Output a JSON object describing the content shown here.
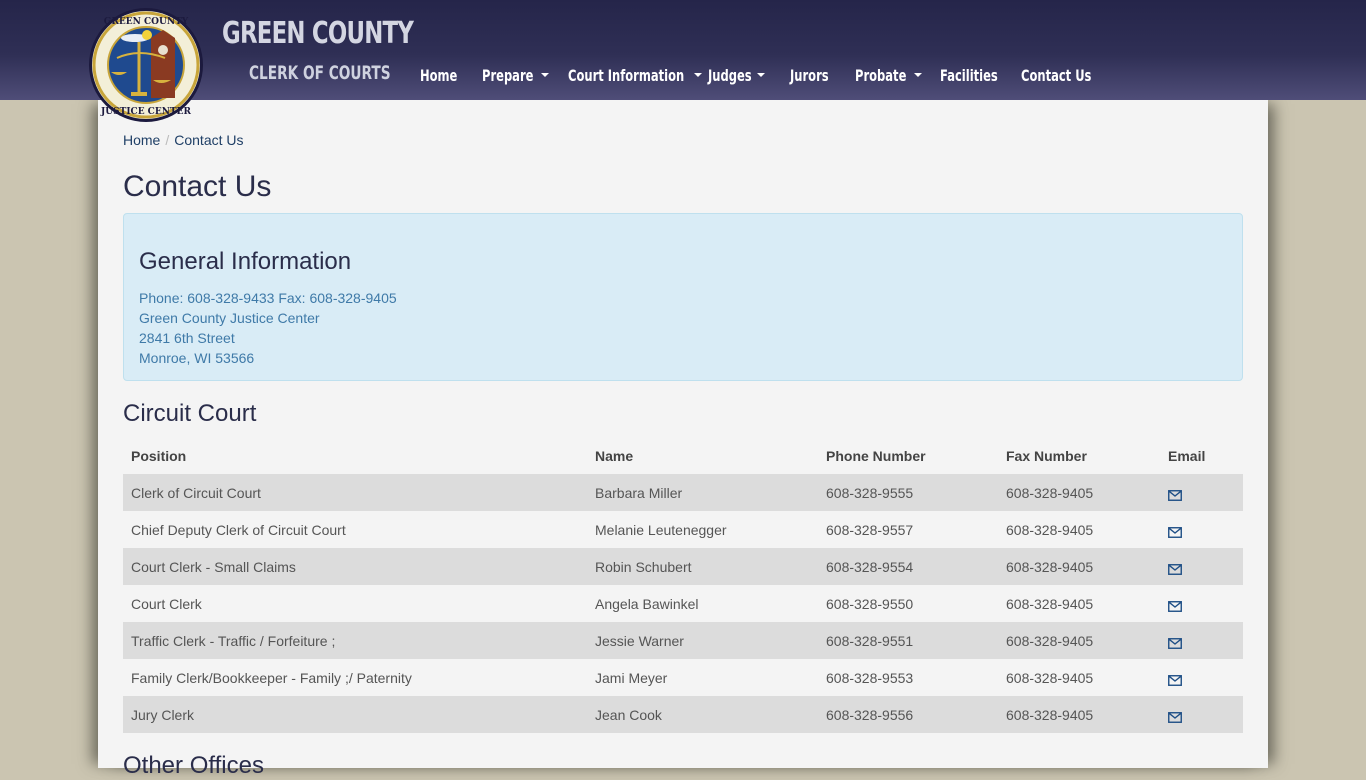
{
  "brand": {
    "title": "GREEN COUNTY",
    "subtitle": "CLERK OF COURTS",
    "logo_alt": "Green County Justice Center seal"
  },
  "nav": [
    {
      "label": "Home",
      "dropdown": false
    },
    {
      "label": "Prepare",
      "dropdown": true
    },
    {
      "label": "Court Information",
      "dropdown": true
    },
    {
      "label": "Judges",
      "dropdown": true
    },
    {
      "label": "Jurors",
      "dropdown": false
    },
    {
      "label": "Probate",
      "dropdown": true
    },
    {
      "label": "Facilities",
      "dropdown": false
    },
    {
      "label": "Contact Us",
      "dropdown": false
    }
  ],
  "breadcrumb": {
    "home": "Home",
    "separator": "/",
    "current": "Contact Us"
  },
  "page_title": "Contact Us",
  "general_info": {
    "heading": "General Information",
    "phone_line": "Phone: 608-328-9433 Fax: 608-328-9405",
    "org": "Green County Justice Center",
    "street": "2841 6th Street",
    "city": "Monroe, WI 53566"
  },
  "circuit_court": {
    "heading": "Circuit Court",
    "columns": [
      "Position",
      "Name",
      "Phone Number",
      "Fax Number",
      "Email"
    ],
    "rows": [
      {
        "position": "Clerk of Circuit Court",
        "name": "Barbara Miller",
        "phone": "608-328-9555",
        "fax": "608-328-9405",
        "email_icon": "envelope-icon"
      },
      {
        "position": "Chief Deputy Clerk of Circuit Court",
        "name": "Melanie Leutenegger",
        "phone": "608-328-9557",
        "fax": "608-328-9405",
        "email_icon": "envelope-icon"
      },
      {
        "position": "Court Clerk - Small Claims",
        "name": "Robin Schubert",
        "phone": "608-328-9554",
        "fax": "608-328-9405",
        "email_icon": "envelope-icon"
      },
      {
        "position": "Court Clerk",
        "name": "Angela Bawinkel",
        "phone": "608-328-9550",
        "fax": "608-328-9405",
        "email_icon": "envelope-icon"
      },
      {
        "position": "Traffic Clerk - Traffic / Forfeiture ;",
        "name": "Jessie Warner",
        "phone": "608-328-9551",
        "fax": "608-328-9405",
        "email_icon": "envelope-icon"
      },
      {
        "position": "Family Clerk/Bookkeeper - Family ;/ Paternity",
        "name": "Jami Meyer",
        "phone": "608-328-9553",
        "fax": "608-328-9405",
        "email_icon": "envelope-icon"
      },
      {
        "position": "Jury Clerk",
        "name": "Jean Cook",
        "phone": "608-328-9556",
        "fax": "608-328-9405",
        "email_icon": "envelope-icon"
      }
    ]
  },
  "other_offices": {
    "heading": "Other Offices"
  },
  "colors": {
    "navbar": "#2f2f55",
    "background": "#cbc5b1",
    "page": "#f4f4f4",
    "info_box": "#d9ecf6",
    "link": "#1f3f66",
    "info_text": "#3f7aa8",
    "row_stripe": "#dcdcdc"
  }
}
